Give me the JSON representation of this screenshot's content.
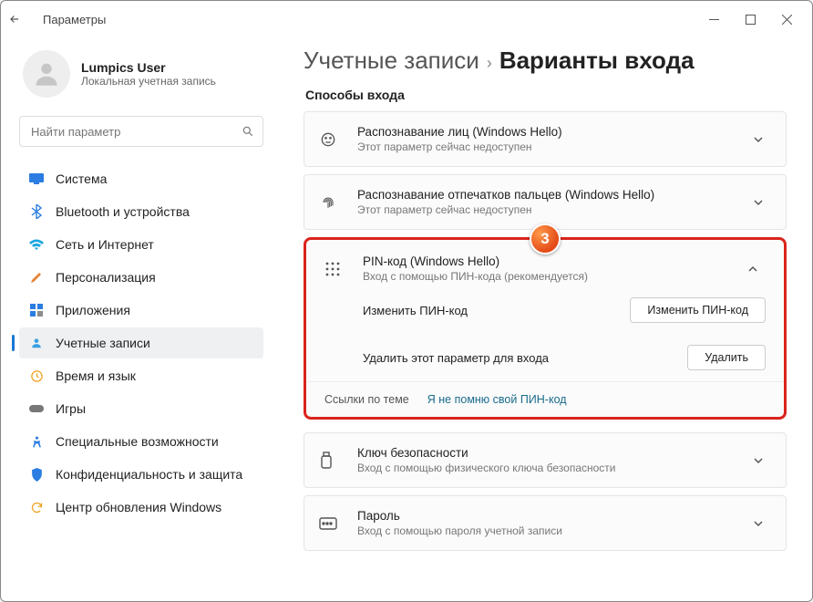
{
  "titlebar": {
    "title": "Параметры"
  },
  "user": {
    "name": "Lumpics User",
    "sub": "Локальная учетная запись"
  },
  "search": {
    "placeholder": "Найти параметр"
  },
  "sidebar": {
    "items": [
      {
        "label": "Система"
      },
      {
        "label": "Bluetooth и устройства"
      },
      {
        "label": "Сеть и Интернет"
      },
      {
        "label": "Персонализация"
      },
      {
        "label": "Приложения"
      },
      {
        "label": "Учетные записи"
      },
      {
        "label": "Время и язык"
      },
      {
        "label": "Игры"
      },
      {
        "label": "Специальные возможности"
      },
      {
        "label": "Конфиденциальность и защита"
      },
      {
        "label": "Центр обновления Windows"
      }
    ]
  },
  "breadcrumb": {
    "parent": "Учетные записи",
    "current": "Варианты входа"
  },
  "section_heading": "Способы входа",
  "options": {
    "face": {
      "title": "Распознавание лиц (Windows Hello)",
      "sub": "Этот параметр сейчас недоступен"
    },
    "finger": {
      "title": "Распознавание отпечатков пальцев (Windows Hello)",
      "sub": "Этот параметр сейчас недоступен"
    },
    "pin": {
      "title": "PIN-код (Windows Hello)",
      "sub": "Вход с помощью ПИН-кода (рекомендуется)",
      "change_label": "Изменить ПИН-код",
      "change_button": "Изменить ПИН-код",
      "remove_label": "Удалить этот параметр для входа",
      "remove_button": "Удалить",
      "links_heading": "Ссылки по теме",
      "forgot_link": "Я не помню свой ПИН-код"
    },
    "key": {
      "title": "Ключ безопасности",
      "sub": "Вход с помощью физического ключа безопасности"
    },
    "pass": {
      "title": "Пароль",
      "sub": "Вход с помощью пароля учетной записи"
    }
  },
  "annotation": {
    "step": "3"
  }
}
